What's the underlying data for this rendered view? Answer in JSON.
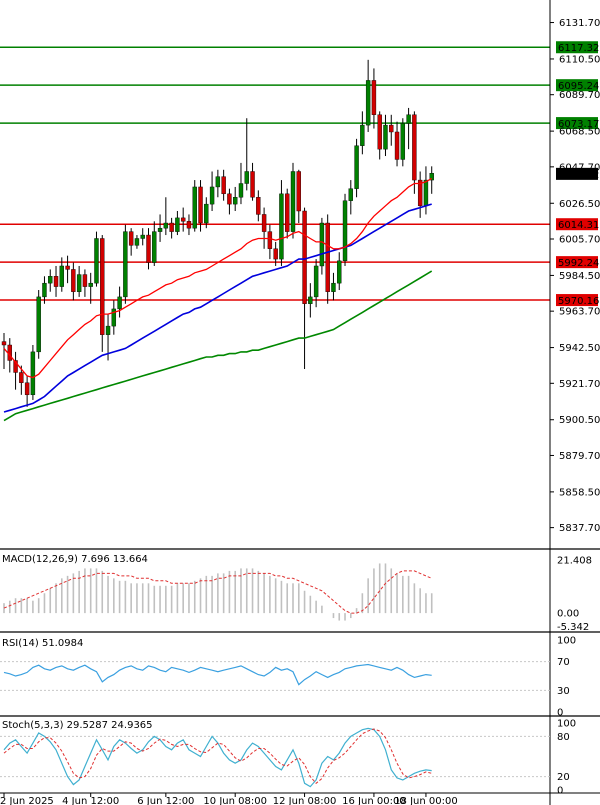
{
  "colors": {
    "bull": "#008000",
    "bear": "#d10000",
    "ma_fast": "#ff0000",
    "ma_mid": "#0000dd",
    "ma_slow": "#008800",
    "resistance": "#008000",
    "support": "#e00000",
    "grid": "#c8c8c8",
    "macd_hist": "#c0c0c0",
    "macd_signal": "#e03030",
    "rsi_line": "#3aa0e0",
    "stoch_main": "#40b0d0",
    "stoch_signal": "#e03030"
  },
  "chart_data": [
    {
      "type": "candlestick",
      "panel": "price",
      "ylim": [
        5827,
        6139
      ],
      "yticks": [
        "6131.70",
        "6110.50",
        "6089.70",
        "6068.50",
        "6047.70",
        "6026.50",
        "6005.70",
        "5984.50",
        "5963.70",
        "5942.50",
        "5921.70",
        "5900.50",
        "5879.70",
        "5858.50",
        "5837.70"
      ],
      "xlabels": [
        "2 Jun 2025",
        "4 Jun 12:00",
        "6 Jun 12:00",
        "10 Jun 08:00",
        "12 Jun 08:00",
        "16 Jun 00:00",
        "18 Jun 00:00"
      ],
      "current_price": "6043.62",
      "levels": [
        {
          "label": "6117.32",
          "value": 6117.32,
          "kind": "resistance"
        },
        {
          "label": "6095.24",
          "value": 6095.24,
          "kind": "resistance"
        },
        {
          "label": "6073.17",
          "value": 6073.17,
          "kind": "resistance"
        },
        {
          "label": "6014.31",
          "value": 6014.31,
          "kind": "support"
        },
        {
          "label": "5992.24",
          "value": 5992.24,
          "kind": "support"
        },
        {
          "label": "5970.16",
          "value": 5970.16,
          "kind": "support"
        }
      ],
      "candles": [
        [
          5946,
          5944,
          5930,
          5951
        ],
        [
          5944,
          5935,
          5928,
          5948
        ],
        [
          5935,
          5928,
          5918,
          5940
        ],
        [
          5928,
          5922,
          5915,
          5932
        ],
        [
          5922,
          5915,
          5908,
          5926
        ],
        [
          5915,
          5940,
          5912,
          5944
        ],
        [
          5940,
          5972,
          5936,
          5976
        ],
        [
          5972,
          5980,
          5968,
          5984
        ],
        [
          5980,
          5984,
          5975,
          5988
        ],
        [
          5984,
          5978,
          5972,
          5990
        ],
        [
          5978,
          5990,
          5975,
          5995
        ],
        [
          5990,
          5988,
          5980,
          5996
        ],
        [
          5988,
          5975,
          5970,
          5992
        ],
        [
          5975,
          5985,
          5972,
          5990
        ],
        [
          5985,
          5978,
          5972,
          5988
        ],
        [
          5978,
          5980,
          5968,
          5986
        ],
        [
          5980,
          6006,
          5978,
          6010
        ],
        [
          6006,
          5950,
          5940,
          6008
        ],
        [
          5950,
          5955,
          5935,
          5962
        ],
        [
          5955,
          5965,
          5950,
          5970
        ],
        [
          5965,
          5972,
          5960,
          5978
        ],
        [
          5972,
          6010,
          5968,
          6014
        ],
        [
          6010,
          6002,
          5996,
          6012
        ],
        [
          6002,
          6006,
          6000,
          6008
        ],
        [
          6006,
          6008,
          6002,
          6012
        ],
        [
          6008,
          5992,
          5988,
          6012
        ],
        [
          5992,
          6010,
          5990,
          6016
        ],
        [
          6010,
          6012,
          6004,
          6020
        ],
        [
          6012,
          6015,
          6008,
          6030
        ],
        [
          6015,
          6010,
          6006,
          6018
        ],
        [
          6010,
          6018,
          6008,
          6022
        ],
        [
          6018,
          6016,
          6010,
          6024
        ],
        [
          6016,
          6012,
          6008,
          6020
        ],
        [
          6012,
          6036,
          6010,
          6040
        ],
        [
          6036,
          6015,
          6010,
          6040
        ],
        [
          6015,
          6026,
          6012,
          6030
        ],
        [
          6026,
          6036,
          6022,
          6045
        ],
        [
          6036,
          6042,
          6030,
          6046
        ],
        [
          6042,
          6032,
          6028,
          6046
        ],
        [
          6032,
          6026,
          6020,
          6035
        ],
        [
          6026,
          6030,
          6022,
          6036
        ],
        [
          6030,
          6038,
          6026,
          6050
        ],
        [
          6038,
          6045,
          6034,
          6076
        ],
        [
          6045,
          6030,
          6028,
          6050
        ],
        [
          6030,
          6020,
          6016,
          6034
        ],
        [
          6020,
          6010,
          6000,
          6024
        ],
        [
          6010,
          6000,
          5994,
          6014
        ],
        [
          6000,
          5994,
          5990,
          6004
        ],
        [
          5994,
          6032,
          5990,
          6040
        ],
        [
          6032,
          6010,
          6006,
          6035
        ],
        [
          6010,
          6045,
          6006,
          6050
        ],
        [
          6045,
          6022,
          6015,
          6046
        ],
        [
          6022,
          5968,
          5930,
          6024
        ],
        [
          5968,
          5972,
          5960,
          5980
        ],
        [
          5972,
          5990,
          5966,
          5994
        ],
        [
          5990,
          6015,
          5985,
          6018
        ],
        [
          6015,
          5975,
          5968,
          6020
        ],
        [
          5975,
          5980,
          5970,
          5986
        ],
        [
          5980,
          5993,
          5976,
          5998
        ],
        [
          5993,
          6028,
          5990,
          6032
        ],
        [
          6028,
          6035,
          6020,
          6040
        ],
        [
          6035,
          6060,
          6030,
          6064
        ],
        [
          6060,
          6072,
          6055,
          6080
        ],
        [
          6072,
          6098,
          6068,
          6110
        ],
        [
          6098,
          6078,
          6070,
          6105
        ],
        [
          6078,
          6058,
          6052,
          6080
        ],
        [
          6058,
          6072,
          6054,
          6078
        ],
        [
          6072,
          6068,
          6060,
          6078
        ],
        [
          6068,
          6052,
          6048,
          6074
        ],
        [
          6052,
          6073,
          6048,
          6076
        ],
        [
          6073,
          6078,
          6058,
          6082
        ],
        [
          6078,
          6040,
          6032,
          6080
        ],
        [
          6040,
          6025,
          6018,
          6045
        ],
        [
          6025,
          6040,
          6020,
          6048
        ],
        [
          6040,
          6044,
          6032,
          6048
        ]
      ],
      "ma_fast": [
        5942,
        5938,
        5934,
        5930,
        5926,
        5925,
        5927,
        5931,
        5935,
        5939,
        5943,
        5947,
        5950,
        5953,
        5956,
        5958,
        5961,
        5962,
        5962,
        5963,
        5964,
        5966,
        5968,
        5970,
        5972,
        5973,
        5975,
        5977,
        5979,
        5980,
        5982,
        5983,
        5984,
        5986,
        5987,
        5988,
        5990,
        5992,
        5994,
        5996,
        5998,
        6000,
        6003,
        6005,
        6006,
        6006,
        6006,
        6005,
        6006,
        6007,
        6009,
        6010,
        6008,
        6006,
        6004,
        6004,
        6002,
        6000,
        6000,
        6001,
        6003,
        6006,
        6010,
        6015,
        6019,
        6022,
        6025,
        6028,
        6030,
        6033,
        6036,
        6038,
        6038,
        6039,
        6041
      ],
      "ma_mid": [
        5905,
        5906,
        5907,
        5908,
        5909,
        5910,
        5912,
        5914,
        5917,
        5920,
        5923,
        5926,
        5928,
        5930,
        5932,
        5934,
        5936,
        5938,
        5939,
        5940,
        5941,
        5942,
        5944,
        5946,
        5948,
        5950,
        5952,
        5954,
        5956,
        5958,
        5960,
        5962,
        5963,
        5965,
        5966,
        5968,
        5970,
        5972,
        5974,
        5976,
        5978,
        5980,
        5982,
        5984,
        5985,
        5986,
        5987,
        5988,
        5989,
        5990,
        5992,
        5994,
        5994,
        5995,
        5996,
        5997,
        5998,
        5999,
        6000,
        6001,
        6002,
        6004,
        6006,
        6008,
        6010,
        6012,
        6014,
        6016,
        6018,
        6020,
        6022,
        6023,
        6024,
        6025,
        6026
      ],
      "ma_slow": [
        5900,
        5902,
        5904,
        5905,
        5906,
        5907,
        5908,
        5909,
        5910,
        5911,
        5912,
        5913,
        5914,
        5915,
        5916,
        5917,
        5918,
        5919,
        5920,
        5921,
        5922,
        5923,
        5924,
        5925,
        5926,
        5927,
        5928,
        5929,
        5930,
        5931,
        5932,
        5933,
        5934,
        5935,
        5936,
        5937,
        5937,
        5938,
        5938,
        5939,
        5939,
        5940,
        5940,
        5941,
        5941,
        5942,
        5943,
        5944,
        5945,
        5946,
        5947,
        5948,
        5948,
        5949,
        5950,
        5951,
        5952,
        5953,
        5955,
        5957,
        5959,
        5961,
        5963,
        5965,
        5967,
        5969,
        5971,
        5973,
        5975,
        5977,
        5979,
        5981,
        5983,
        5985,
        5987
      ]
    },
    {
      "type": "bar",
      "panel": "macd",
      "title": "MACD(12,26,9) 7.696 13.664",
      "ylim": [
        -6,
        23
      ],
      "yticks": [
        "21.408",
        "0.00",
        "-5.342"
      ],
      "histogram": [
        4,
        5,
        6,
        6,
        6,
        5,
        6,
        8,
        10,
        12,
        14,
        15,
        16,
        17,
        18,
        18,
        18,
        17,
        15,
        14,
        13,
        13,
        12,
        12,
        12,
        12,
        11,
        11,
        11,
        11,
        12,
        12,
        12,
        13,
        14,
        15,
        15,
        16,
        16,
        17,
        17,
        18,
        18,
        18,
        17,
        16,
        15,
        14,
        13,
        12,
        12,
        12,
        9,
        7,
        5,
        3,
        0,
        -2,
        -3,
        -3,
        -2,
        2,
        8,
        14,
        18,
        20,
        20,
        18,
        16,
        15,
        15,
        12,
        10,
        8,
        8
      ],
      "signal": [
        2,
        3,
        4,
        5,
        6,
        7,
        8,
        9,
        10,
        11,
        12,
        13,
        14,
        14,
        15,
        15,
        16,
        16,
        16,
        16,
        15,
        15,
        15,
        14,
        14,
        14,
        13,
        13,
        13,
        12,
        12,
        12,
        12,
        12,
        13,
        13,
        13,
        14,
        14,
        15,
        15,
        15,
        16,
        16,
        16,
        16,
        16,
        15,
        15,
        14,
        14,
        13,
        12,
        11,
        10,
        9,
        7,
        5,
        3,
        1,
        0,
        0,
        1,
        3,
        6,
        9,
        12,
        14,
        16,
        17,
        17,
        17,
        16,
        15,
        14
      ]
    },
    {
      "type": "line",
      "panel": "rsi",
      "title": "RSI(14) 51.0984",
      "ylim": [
        0,
        100
      ],
      "yticks": [
        "100",
        "70",
        "30",
        "0"
      ],
      "values": [
        55,
        53,
        50,
        52,
        55,
        62,
        65,
        60,
        58,
        62,
        64,
        60,
        58,
        62,
        65,
        60,
        56,
        42,
        48,
        52,
        58,
        62,
        64,
        60,
        58,
        64,
        62,
        58,
        56,
        62,
        60,
        58,
        55,
        58,
        62,
        60,
        58,
        56,
        58,
        60,
        62,
        64,
        60,
        56,
        52,
        50,
        55,
        62,
        58,
        60,
        56,
        38,
        45,
        50,
        56,
        52,
        48,
        52,
        55,
        60,
        62,
        64,
        65,
        66,
        64,
        62,
        60,
        58,
        62,
        58,
        52,
        48,
        50,
        52,
        51
      ]
    },
    {
      "type": "line",
      "panel": "stochastic",
      "title": "Stoch(5,3,3) 29.5287 24.9365",
      "ylim": [
        0,
        100
      ],
      "yticks": [
        "100",
        "80",
        "20",
        "0"
      ],
      "main": [
        60,
        70,
        75,
        65,
        55,
        70,
        85,
        80,
        72,
        60,
        40,
        20,
        8,
        15,
        35,
        55,
        75,
        60,
        45,
        65,
        75,
        70,
        62,
        55,
        60,
        72,
        80,
        75,
        65,
        60,
        70,
        75,
        60,
        55,
        50,
        65,
        80,
        70,
        55,
        45,
        40,
        45,
        60,
        70,
        65,
        55,
        45,
        35,
        30,
        45,
        60,
        40,
        10,
        5,
        15,
        40,
        50,
        45,
        55,
        70,
        80,
        85,
        90,
        92,
        90,
        80,
        60,
        30,
        18,
        15,
        20,
        25,
        28,
        30,
        29
      ],
      "signal": [
        55,
        62,
        68,
        68,
        62,
        62,
        72,
        78,
        78,
        70,
        58,
        42,
        25,
        18,
        20,
        32,
        52,
        62,
        58,
        58,
        65,
        72,
        70,
        62,
        58,
        62,
        70,
        76,
        74,
        68,
        65,
        68,
        68,
        62,
        57,
        56,
        63,
        70,
        68,
        58,
        48,
        43,
        48,
        56,
        62,
        62,
        55,
        46,
        38,
        36,
        43,
        48,
        38,
        20,
        10,
        17,
        33,
        44,
        48,
        55,
        65,
        75,
        84,
        88,
        91,
        88,
        78,
        60,
        40,
        24,
        18,
        20,
        23,
        27,
        25
      ]
    }
  ]
}
